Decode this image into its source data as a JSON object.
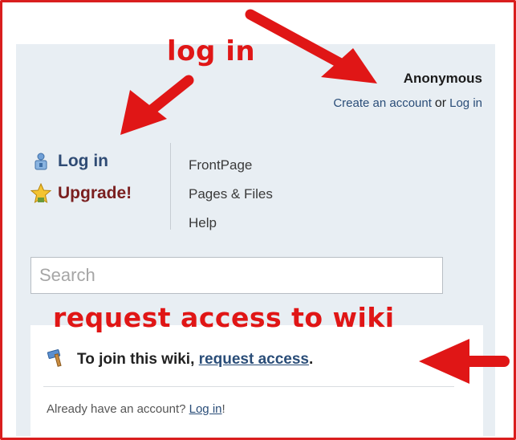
{
  "user": {
    "name": "Anonymous",
    "create_account_label": "Create an account",
    "or_label": "or",
    "login_label": "Log in"
  },
  "nav_left": {
    "login_label": "Log in",
    "upgrade_label": "Upgrade!"
  },
  "nav_right": {
    "items": [
      {
        "label": "FrontPage"
      },
      {
        "label": "Pages & Files"
      },
      {
        "label": "Help"
      }
    ]
  },
  "search": {
    "placeholder": "Search"
  },
  "join": {
    "prefix": "To join this wiki,",
    "request_access_label": "request access",
    "suffix": "."
  },
  "already": {
    "prefix": "Already have an account?",
    "login_label": "Log in",
    "suffix": "!"
  },
  "annotations": {
    "login": "log in",
    "request": "request access to wiki"
  },
  "colors": {
    "annotation_red": "#e01616",
    "link_blue": "#2a4d78",
    "panel_bg": "#e8eef3"
  },
  "icons": {
    "login": "user-lock-icon",
    "upgrade": "star-icon",
    "join": "hammer-icon"
  }
}
